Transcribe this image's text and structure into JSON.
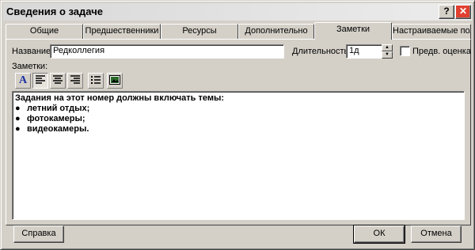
{
  "window": {
    "title": "Сведения о задаче",
    "help_glyph": "?",
    "close_glyph": "✕"
  },
  "tabs": [
    {
      "label": "Общие"
    },
    {
      "label": "Предшественники"
    },
    {
      "label": "Ресурсы"
    },
    {
      "label": "Дополнительно"
    },
    {
      "label": "Заметки",
      "active": true
    },
    {
      "label": "Настраиваемые поля"
    }
  ],
  "form": {
    "name_label": "Название:",
    "name_value": "Редколлегия",
    "duration_label": "Длительность:",
    "duration_value": "1д",
    "estimate_label": "Предв. оценка",
    "notes_label": "Заметки:"
  },
  "toolbar": {
    "font_glyph": "A",
    "icons": [
      "font-icon",
      "align-left-icon",
      "align-center-icon",
      "align-right-icon",
      "bullets-icon",
      "insert-object-icon"
    ]
  },
  "notes": {
    "heading": "Задания на этот номер должны включать темы:",
    "bullet_glyph": "●",
    "items": [
      "летний отдых;",
      "фотокамеры;",
      "видеокамеры."
    ]
  },
  "buttons": {
    "help": "Справка",
    "ok": "ОК",
    "cancel": "Отмена"
  }
}
